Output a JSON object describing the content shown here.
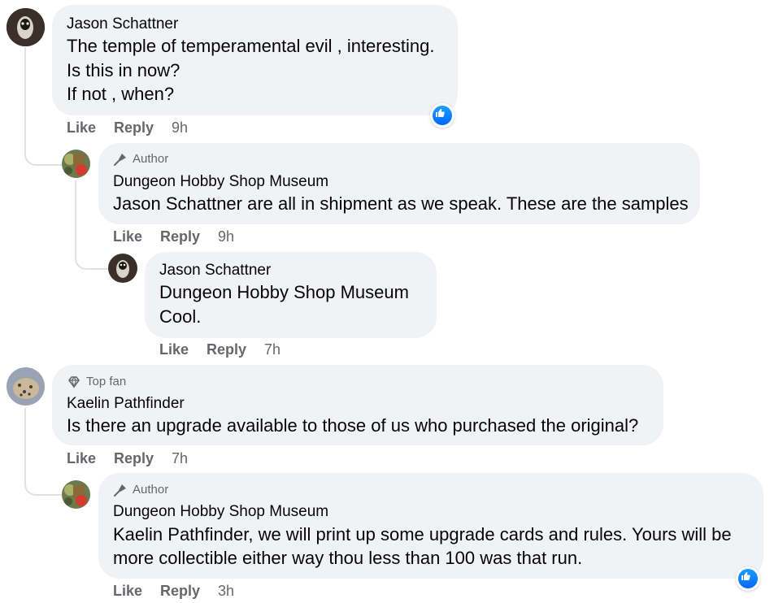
{
  "comments": [
    {
      "author": "Jason Schattner",
      "lines": [
        "The temple of temperamental evil , interesting.",
        "Is this in now?",
        "If not , when?"
      ],
      "actions": {
        "like": "Like",
        "reply": "Reply",
        "time": "9h"
      }
    },
    {
      "badge": "Author",
      "author": "Dungeon Hobby Shop Museum",
      "mention": "Jason Schattner",
      "text": " are all in shipment as we speak. These are the samples",
      "actions": {
        "like": "Like",
        "reply": "Reply",
        "time": "9h"
      }
    },
    {
      "author": "Jason Schattner",
      "mention": "Dungeon Hobby Shop Museum",
      "text": "Cool.",
      "actions": {
        "like": "Like",
        "reply": "Reply",
        "time": "7h"
      }
    },
    {
      "badge": "Top fan",
      "author": "Kaelin Pathfinder",
      "text": "Is there an upgrade available to those of us who purchased the original?",
      "actions": {
        "like": "Like",
        "reply": "Reply",
        "time": "7h"
      }
    },
    {
      "badge": "Author",
      "author": "Dungeon Hobby Shop Museum",
      "mention": "Kaelin Pathfinder",
      "text1": ", we will print up some upgrade cards and rules. Yours will be",
      "text2": "more collectible either way thou less than 100 was that run.",
      "actions": {
        "like": "Like",
        "reply": "Reply",
        "time": "3h"
      }
    }
  ],
  "colors": {
    "bubble": "#f0f2f5",
    "meta": "#65676b",
    "like_blue": "#0866ff"
  }
}
